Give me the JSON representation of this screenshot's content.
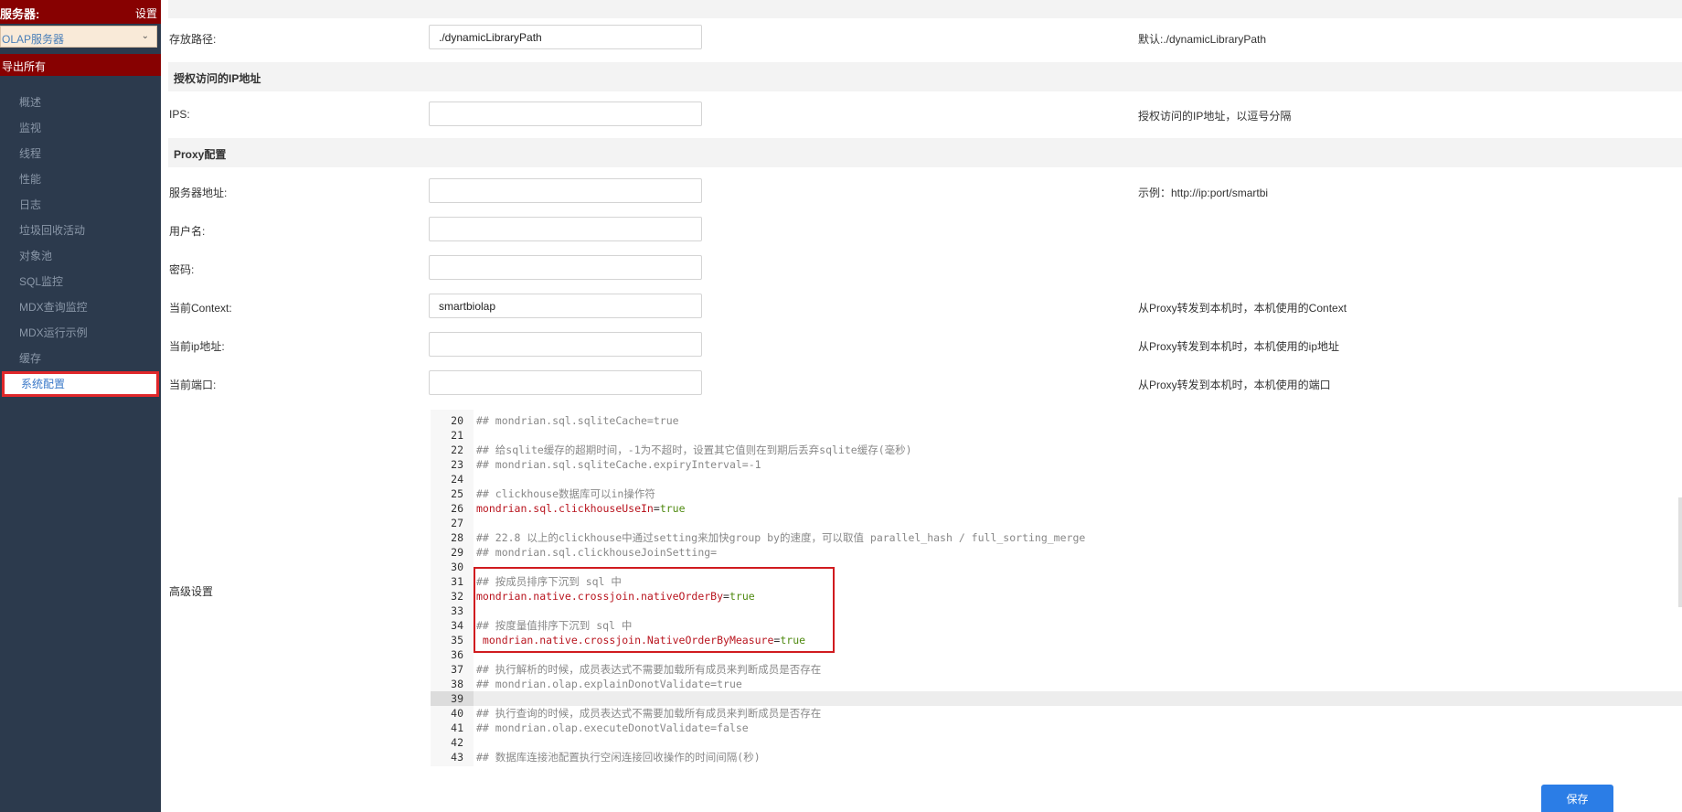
{
  "sidebar": {
    "server_label": "服务器:",
    "settings_label": "设置",
    "server_select_value": "OLAP服务器",
    "export_all_label": "导出所有",
    "items": [
      {
        "label": "概述"
      },
      {
        "label": "监视"
      },
      {
        "label": "线程"
      },
      {
        "label": "性能"
      },
      {
        "label": "日志"
      },
      {
        "label": "垃圾回收活动"
      },
      {
        "label": "对象池"
      },
      {
        "label": "SQL监控"
      },
      {
        "label": "MDX查询监控"
      },
      {
        "label": "MDX运行示例"
      },
      {
        "label": "缓存"
      },
      {
        "label": "系统配置",
        "active": true
      }
    ],
    "colors": {
      "bar": "#870101",
      "bg": "#2c3a4d",
      "active_border": "#e0272a"
    }
  },
  "form": {
    "storage_path": {
      "label": "存放路径:",
      "value": "./dynamicLibraryPath",
      "hint": "默认:./dynamicLibraryPath"
    },
    "ip_section_title": "授权访问的IP地址",
    "ips": {
      "label": "IPS:",
      "value": "",
      "hint": "授权访问的IP地址，以逗号分隔"
    },
    "proxy_section_title": "Proxy配置",
    "server_address": {
      "label": "服务器地址:",
      "value": "",
      "hint": "示例：http://ip:port/smartbi"
    },
    "username": {
      "label": "用户名:",
      "value": ""
    },
    "password": {
      "label": "密码:",
      "value": ""
    },
    "current_context": {
      "label": "当前Context:",
      "value": "smartbiolap",
      "hint": "从Proxy转发到本机时，本机使用的Context"
    },
    "current_ip": {
      "label": "当前ip地址:",
      "value": "",
      "hint": "从Proxy转发到本机时，本机使用的ip地址"
    },
    "current_port": {
      "label": "当前端口:",
      "value": "",
      "hint": "从Proxy转发到本机时，本机使用的端口"
    },
    "advanced_label": "高级设置"
  },
  "editor": {
    "lines": [
      {
        "n": "20",
        "text": "## mondrian.sql.sqliteCache=true"
      },
      {
        "n": "21",
        "text": ""
      },
      {
        "n": "22",
        "text": "## 给sqlite缓存的超期时间，-1为不超时，设置其它值则在到期后丢弃sqlite缓存(毫秒)"
      },
      {
        "n": "23",
        "text": "## mondrian.sql.sqliteCache.expiryInterval=-1"
      },
      {
        "n": "24",
        "text": ""
      },
      {
        "n": "25",
        "text": "## clickhouse数据库可以in操作符"
      },
      {
        "n": "26",
        "key": "mondrian.sql.clickhouseUseIn",
        "val": "true"
      },
      {
        "n": "27",
        "text": ""
      },
      {
        "n": "28",
        "text": "## 22.8 以上的clickhouse中通过setting来加快group by的速度，可以取值 parallel_hash / full_sorting_merge"
      },
      {
        "n": "29",
        "text": "## mondrian.sql.clickhouseJoinSetting="
      },
      {
        "n": "30",
        "text": ""
      },
      {
        "n": "31",
        "text": "## 按成员排序下沉到 sql 中"
      },
      {
        "n": "32",
        "key": "mondrian.native.crossjoin.nativeOrderBy",
        "val": "true"
      },
      {
        "n": "33",
        "text": ""
      },
      {
        "n": "34",
        "text": "## 按度量值排序下沉到 sql 中"
      },
      {
        "n": "35",
        "key": " mondrian.native.crossjoin.NativeOrderByMeasure",
        "val": "true"
      },
      {
        "n": "36",
        "text": ""
      },
      {
        "n": "37",
        "text": "## 执行解析的时候，成员表达式不需要加载所有成员来判断成员是否存在"
      },
      {
        "n": "38",
        "text": "## mondrian.olap.explainDonotValidate=true"
      },
      {
        "n": "39",
        "text": "",
        "highlighted": true
      },
      {
        "n": "40",
        "text": "## 执行查询的时候，成员表达式不需要加载所有成员来判断成员是否存在"
      },
      {
        "n": "41",
        "text": "## mondrian.olap.executeDonotValidate=false"
      },
      {
        "n": "42",
        "text": ""
      },
      {
        "n": "43",
        "text": "## 数据库连接池配置执行空闲连接回收操作的时间间隔(秒)"
      }
    ],
    "colors": {
      "key": "#b9151f",
      "value": "#4f8a10",
      "comment": "#888888",
      "highlight_box": "#d01b1f"
    }
  },
  "save_label": "保存",
  "accent": "#2b7de6"
}
